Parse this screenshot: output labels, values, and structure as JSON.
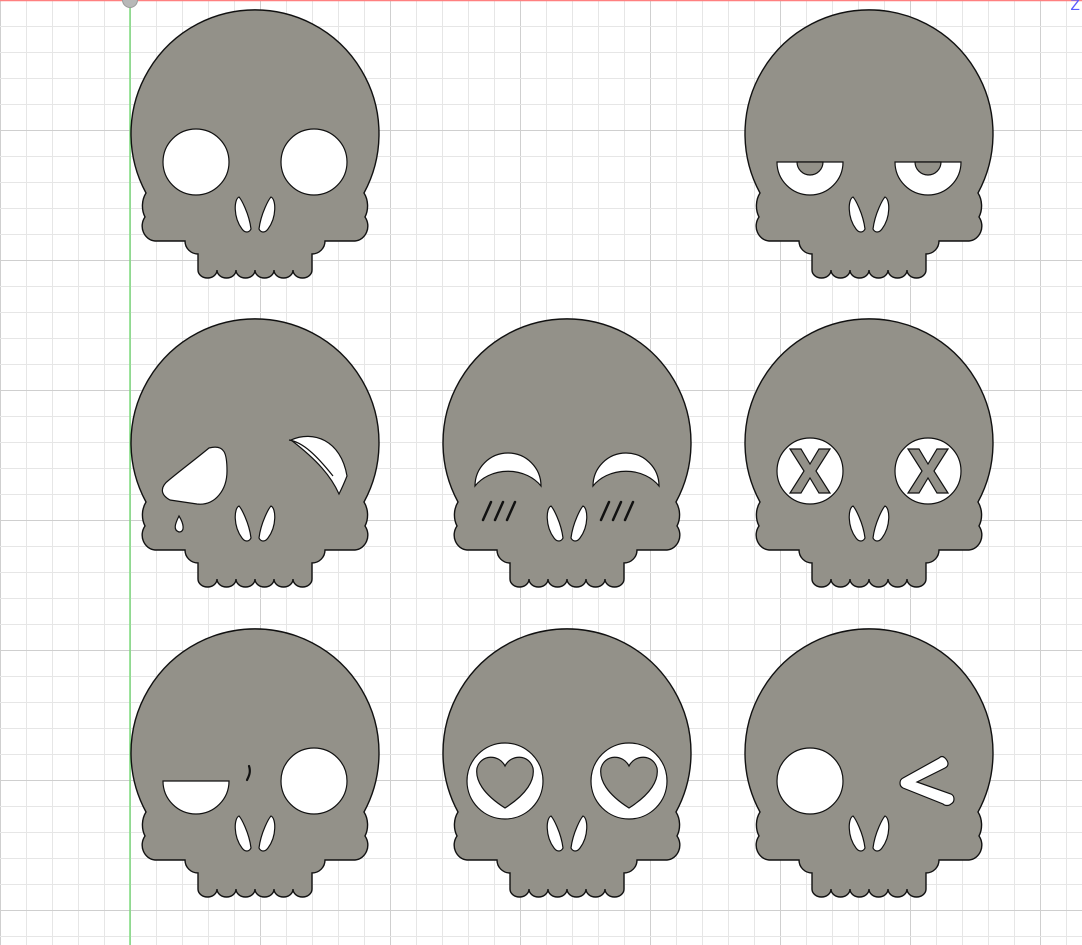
{
  "viewport": {
    "axis_label": "Z",
    "colors": {
      "background": "#ffffff",
      "grid_minor": "#e6e6e6",
      "grid_major": "#cfcfcf",
      "x_axis": "#ff8080",
      "y_axis": "#7ddc7d",
      "skull_fill": "#939189",
      "skull_stroke": "#111111"
    }
  },
  "skulls": [
    {
      "name": "skull-round-eyes",
      "expression": "round-eyes"
    },
    {
      "name": "skull-sleepy-eyes",
      "expression": "sleepy-eyes"
    },
    {
      "name": "skull-crying-wink",
      "expression": "crying-wink"
    },
    {
      "name": "skull-happy-blush",
      "expression": "happy-blush"
    },
    {
      "name": "skull-x-eyes",
      "expression": "x-eyes"
    },
    {
      "name": "skull-half-wink",
      "expression": "half-wink"
    },
    {
      "name": "skull-heart-eyes",
      "expression": "heart-eyes"
    },
    {
      "name": "skull-wink-arrow",
      "expression": "wink-arrow"
    }
  ]
}
